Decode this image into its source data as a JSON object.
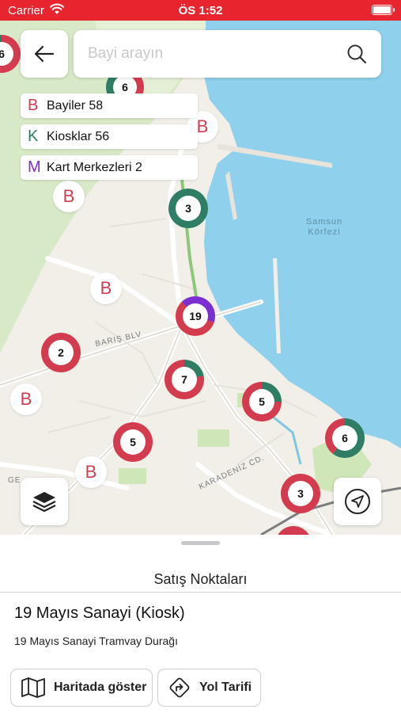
{
  "status_bar": {
    "carrier": "Carrier",
    "time": "ÖS 1:52"
  },
  "search": {
    "placeholder": "Bayi arayın"
  },
  "legend": [
    {
      "letter": "B",
      "label": "Bayiler 58",
      "color": "#d23c4e"
    },
    {
      "letter": "K",
      "label": "Kiosklar 56",
      "color": "#2e7d64"
    },
    {
      "letter": "M",
      "label": "Kart Merkezleri 2",
      "color": "#7b2fd0"
    }
  ],
  "map": {
    "labels": {
      "road_baris": "BARIŞ BLV",
      "road_karadeniz": "KARADENİZ CD.",
      "road_ge": "GE",
      "sea_line1": "Samsun",
      "sea_line2": "Körfezi"
    },
    "clusters": [
      {
        "count": "6",
        "colors": [
          "#d23c4e",
          "#2e7d64"
        ]
      },
      {
        "count": "6",
        "colors": [
          "#d23c4e",
          "#2e7d64"
        ]
      },
      {
        "count": "3",
        "colors": [
          "#2e7d64"
        ]
      },
      {
        "count": "19",
        "colors": [
          "#d23c4e",
          "#7b2fd0"
        ]
      },
      {
        "count": "2",
        "colors": [
          "#d23c4e"
        ]
      },
      {
        "count": "7",
        "colors": [
          "#d23c4e",
          "#2e7d64"
        ]
      },
      {
        "count": "5",
        "colors": [
          "#d23c4e",
          "#2e7d64"
        ]
      },
      {
        "count": "5",
        "colors": [
          "#d23c4e"
        ]
      },
      {
        "count": "6",
        "colors": [
          "#2e7d64",
          "#d23c4e"
        ]
      },
      {
        "count": "3",
        "colors": [
          "#d23c4e"
        ]
      }
    ],
    "pin_letter": "B"
  },
  "sheet": {
    "title": "Satış Noktaları",
    "place_name": "19 Mayıs Sanayi (Kiosk)",
    "place_address": "19 Mayıs Sanayi Tramvay Durağı",
    "show_on_map_label": "Haritada göster",
    "directions_label": "Yol Tarifi"
  },
  "icons": [
    "back-arrow-icon",
    "search-icon",
    "layers-icon",
    "location-arrow-icon",
    "map-icon",
    "directions-icon",
    "wifi-icon",
    "battery-icon"
  ],
  "colors": {
    "accent": "#e8242e",
    "dealer": "#d23c4e",
    "kiosk": "#2e7d64",
    "card_center": "#7b2fd0",
    "sea": "#8fd0ec",
    "park": "#cfe6b8"
  }
}
